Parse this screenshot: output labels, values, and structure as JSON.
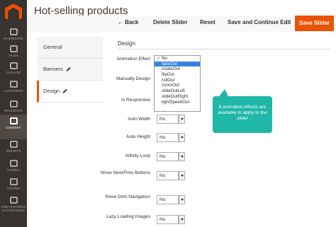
{
  "sidebar": {
    "items": [
      {
        "label": "DASHBOARD",
        "icon": "dashboard-icon"
      },
      {
        "label": "SALES",
        "icon": "dollar-icon"
      },
      {
        "label": "CATALOG",
        "icon": "cube-icon"
      },
      {
        "label": "CUSTOMERS",
        "icon": "person-icon"
      },
      {
        "label": "MARKETING",
        "icon": "megaphone-icon"
      },
      {
        "label": "CONTENT",
        "icon": "layout-icon",
        "active": true
      },
      {
        "label": "REPORTS",
        "icon": "bar-chart-icon"
      },
      {
        "label": "STORES",
        "icon": "store-icon"
      },
      {
        "label": "SYSTEM",
        "icon": "gear-icon"
      },
      {
        "label": "FIND PARTNERS & EXTENSIONS",
        "icon": "puzzle-icon"
      }
    ]
  },
  "header": {
    "title": "Hot-selling products"
  },
  "toolbar": {
    "back": "Back",
    "delete": "Delete Slider",
    "reset": "Reset",
    "save_continue": "Save and Continue Edit",
    "save": "Save Slider"
  },
  "tabs": [
    {
      "label": "General"
    },
    {
      "label": "Banners"
    },
    {
      "label": "Design",
      "active": true
    }
  ],
  "section": {
    "title": "Design"
  },
  "fields": [
    {
      "label": "Animation Effect"
    },
    {
      "label": "Manually Design"
    },
    {
      "label": "Is Responsive"
    },
    {
      "label": "Auto Width",
      "value": "No"
    },
    {
      "label": "Auto Height",
      "value": "No"
    },
    {
      "label": "Infinity Loop",
      "value": "No"
    },
    {
      "label": "Show Next/Prev Buttons",
      "value": "No"
    },
    {
      "label": "Show Dots Navigation",
      "value": "No"
    },
    {
      "label": "Lazy Loading Images",
      "value": "No"
    }
  ],
  "dropdown": {
    "options": [
      "No",
      "fadeOut",
      "rotateOut",
      "flipOut",
      "rollOut",
      "zoomOut",
      "slideOutLeft",
      "slideOutRight",
      "lightSpeedOut"
    ],
    "checked": "No",
    "highlighted": "fadeOut"
  },
  "callout": {
    "text": "8 animation effects are available to apply to the slider"
  },
  "colors": {
    "accent": "#eb5202",
    "sidebar": "#373330",
    "callout": "#1fb7a7",
    "highlight": "#3483de"
  }
}
